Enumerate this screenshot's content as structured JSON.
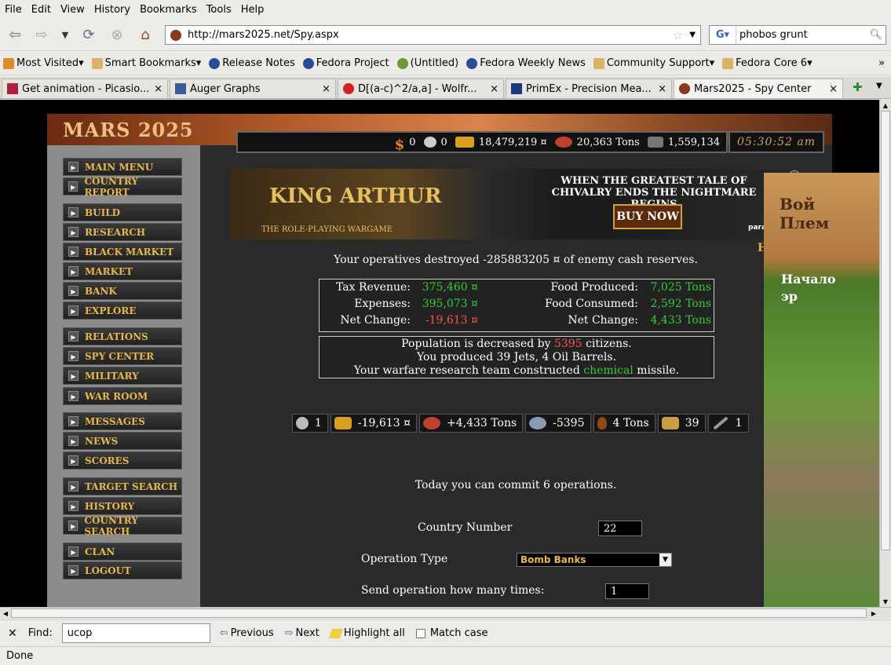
{
  "menubar": {
    "file": "File",
    "edit": "Edit",
    "view": "View",
    "history": "History",
    "bookmarks": "Bookmarks",
    "tools": "Tools",
    "help": "Help"
  },
  "nav": {
    "url": "http://mars2025.net/Spy.aspx",
    "search_value": "phobos grunt"
  },
  "bookmarks": [
    "Most Visited",
    "Smart Bookmarks",
    "Release Notes",
    "Fedora Project",
    "(Untitled)",
    "Fedora Weekly News",
    "Community Support",
    "Fedora Core 6"
  ],
  "tabs": [
    {
      "label": "Get animation - Picasio...",
      "close": "×"
    },
    {
      "label": "Auger Graphs",
      "close": "×"
    },
    {
      "label": "D[(a-c)^2/a,a] - Wolfr...",
      "close": "×"
    },
    {
      "label": "PrimEx - Precision Mea...",
      "close": "×"
    },
    {
      "label": "Mars2025 - Spy Center",
      "close": "×"
    }
  ],
  "game": {
    "logo": "MARS 2025",
    "resources": {
      "money": "0",
      "tech": "0",
      "cash": "18,479,219 ¤",
      "food": "20,363 Tons",
      "land": "1,559,134"
    },
    "clock": "05:30:52 am",
    "menu": [
      "MAIN MENU",
      "COUNTRY REPORT",
      "BUILD",
      "RESEARCH",
      "BLACK MARKET",
      "MARKET",
      "BANK",
      "EXPLORE",
      "RELATIONS",
      "SPY CENTER",
      "MILITARY",
      "WAR ROOM",
      "MESSAGES",
      "NEWS",
      "SCORES",
      "TARGET SEARCH",
      "HISTORY",
      "COUNTRY SEARCH",
      "CLAN",
      "LOGOUT"
    ],
    "banner": {
      "title": "WHEN THE GREATEST TALE OF CHIVALRY ENDS THE NIGHTMARE BEGINS",
      "buy": "BUY NOW",
      "king": "KING ARTHUR",
      "sub": "THE ROLE-PLAYING WARGAME",
      "brand": "paradox",
      "info": "i"
    },
    "help": "Help",
    "message": "Your operatives destroyed -285883205 ¤ of enemy cash reserves.",
    "stats": {
      "tax_label": "Tax Revenue:",
      "tax_value": "375,460 ¤",
      "exp_label": "Expenses:",
      "exp_value": "395,073 ¤",
      "net_label": "Net Change:",
      "net_value": "-19,613 ¤",
      "food_prod_label": "Food Produced:",
      "food_prod_value": "7,025 Tons",
      "food_cons_label": "Food Consumed:",
      "food_cons_value": "2,592 Tons",
      "food_net_label": "Net Change:",
      "food_net_value": "4,433 Tons"
    },
    "notice": {
      "line1_a": "Population is decreased by ",
      "line1_num": "5395",
      "line1_b": " citizens.",
      "line2": "You produced 39 Jets, 4 Oil Barrels.",
      "line3_a": "Your warfare research team constructed ",
      "line3_hl": "chemical",
      "line3_b": " missile."
    },
    "chips": [
      {
        "value": "1",
        "color": "#ffffff",
        "icon": "clock-icon"
      },
      {
        "value": "-19,613 ¤",
        "color": "#ff5544",
        "icon": "gold-icon"
      },
      {
        "value": "+4,433 Tons",
        "color": "#33cc33",
        "icon": "food-icon"
      },
      {
        "value": "-5395",
        "color": "#ff5544",
        "icon": "population-icon"
      },
      {
        "value": "4 Tons",
        "color": "#ffffff",
        "icon": "oil-icon"
      },
      {
        "value": "39",
        "color": "#ffffff",
        "icon": "jets-icon"
      },
      {
        "value": "1",
        "color": "#ffffff",
        "icon": "missile-icon"
      }
    ],
    "ops_text": "Today you can commit 6 operations.",
    "form": {
      "country_label": "Country Number",
      "country_value": "22",
      "op_label": "Operation Type",
      "op_value": "Bomb Banks",
      "times_label": "Send operation how many times:",
      "times_value": "1"
    },
    "right_ad": {
      "line1": "Вой\nПлем",
      "line2": "Начало\nэр"
    }
  },
  "find": {
    "label": "Find:",
    "value": "ucop",
    "previous": "Previous",
    "next": "Next",
    "highlight": "Highlight all",
    "match": "Match case"
  },
  "status": "Done"
}
